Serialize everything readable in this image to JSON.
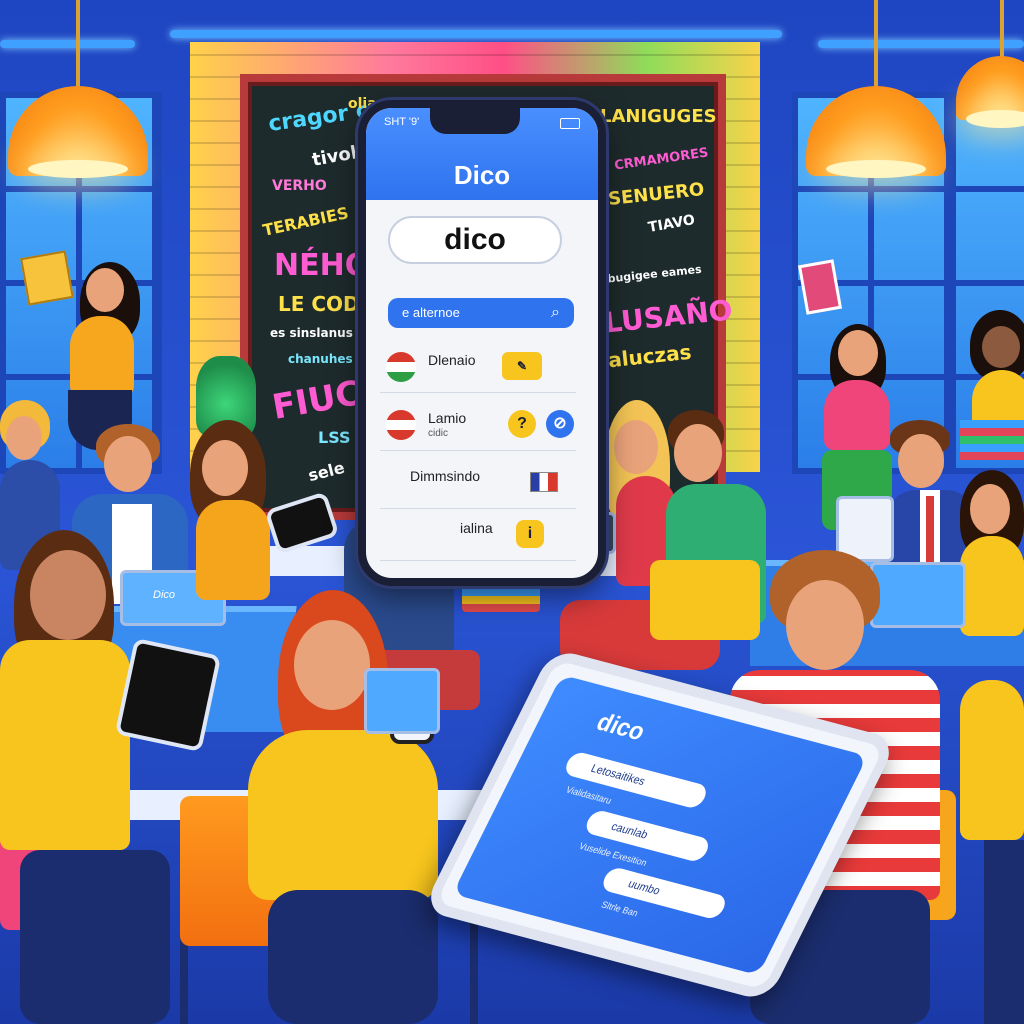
{
  "chalkboard": {
    "words_left": [
      "cragor ca",
      "olia",
      "tivol",
      "VERHO",
      "TERABIES",
      "NÉHO",
      "LE CODO",
      "es sinslanus",
      "chanuhes",
      "FIUCÓ",
      "LSS",
      "sele"
    ],
    "words_right": [
      "LANIGUGES",
      "CRMAMORES",
      "SENUERO",
      "TIAVO",
      "abugigee eames",
      "LUSAÑO",
      "aluczas"
    ]
  },
  "phone": {
    "status_text": "SHT '9'",
    "app_name": "Dico",
    "search_value": "dico",
    "search_bar_text": "e alternoe",
    "rows": [
      {
        "label": "Dlenaio",
        "sub": ""
      },
      {
        "label": "Lamio",
        "sub": "cidic"
      },
      {
        "label": "Dimmsindo",
        "sub": ""
      },
      {
        "label": "ialina",
        "sub": ""
      }
    ]
  },
  "laptop_small": {
    "brand": "Dico"
  },
  "tablet": {
    "app_name": "dico",
    "options": [
      "Letosaitikes",
      "caunlab",
      "uumbo"
    ],
    "captions": [
      "Vialidasitaru",
      "Vuselide Exesition",
      "Sltrle Ban"
    ]
  },
  "colors": {
    "wall_blue": "#1f46c2",
    "chalkboard": "#1e2b2c",
    "phone_header": "#2f73ef",
    "lamp_orange": "#ff9d1f"
  }
}
